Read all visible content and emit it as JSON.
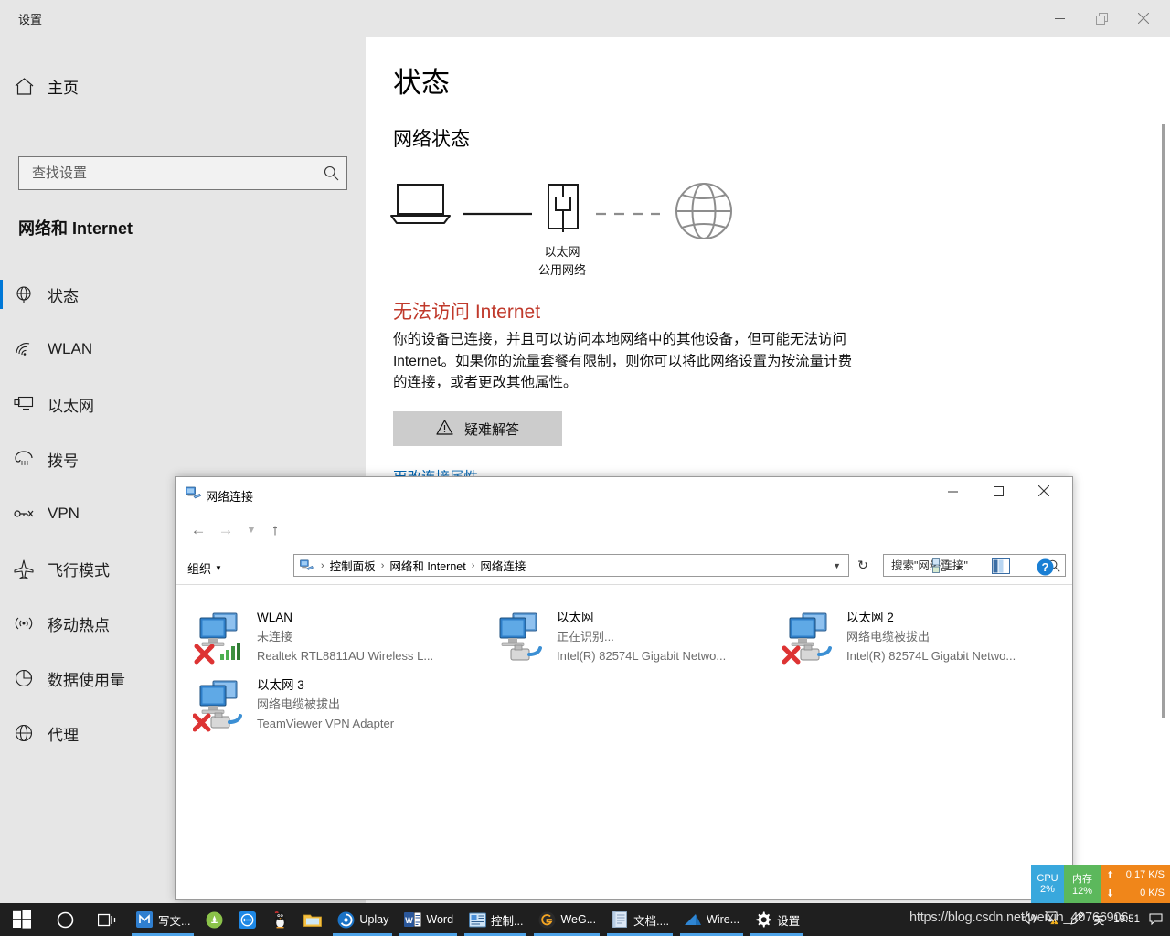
{
  "settings": {
    "window_title": "设置",
    "titlebar_buttons": {
      "minimize": "minimize-icon",
      "maximize": "maximize-icon",
      "close": "close-icon"
    },
    "home_label": "主页",
    "search_placeholder": "查找设置",
    "search_value": "",
    "category_title": "网络和 Internet",
    "nav_items": [
      {
        "label": "状态",
        "icon": "globe-status-icon",
        "selected": true
      },
      {
        "label": "WLAN",
        "icon": "wifi-icon",
        "selected": false
      },
      {
        "label": "以太网",
        "icon": "ethernet-icon",
        "selected": false
      },
      {
        "label": "拨号",
        "icon": "dialup-phone-icon",
        "selected": false
      },
      {
        "label": "VPN",
        "icon": "vpn-key-icon",
        "selected": false
      },
      {
        "label": "飞行模式",
        "icon": "airplane-icon",
        "selected": false
      },
      {
        "label": "移动热点",
        "icon": "hotspot-icon",
        "selected": false
      },
      {
        "label": "数据使用量",
        "icon": "data-usage-pie-icon",
        "selected": false
      },
      {
        "label": "代理",
        "icon": "proxy-globe-icon",
        "selected": false
      }
    ],
    "page_title": "状态",
    "section_title": "网络状态",
    "diagram": {
      "device_icon": "laptop-icon",
      "adapter_icon": "ethernet-port-icon",
      "internet_icon": "globe-icon",
      "adapter_label": "以太网",
      "network_type_label": "公用网络"
    },
    "status_headline": "无法访问 Internet",
    "status_headline_color": "#c0392b",
    "status_body": "你的设备已连接，并且可以访问本地网络中的其他设备，但可能无法访问 Internet。如果你的流量套餐有限制，则你可以将此网络设置为按流量计费的连接，或者更改其他属性。",
    "troubleshoot_label": "疑难解答",
    "change_props_link": "更改连接属性",
    "accent_color": "#0078d7"
  },
  "explorer": {
    "window_title": "网络连接",
    "titlebar_buttons": {
      "minimize": "minimize-icon",
      "maximize": "maximize-icon",
      "close": "close-icon"
    },
    "breadcrumbs": [
      "控制面板",
      "网络和 Internet",
      "网络连接"
    ],
    "search_placeholder": "搜索\"网络连接\"",
    "search_value": "",
    "organize_label": "组织",
    "connections": [
      {
        "name": "WLAN",
        "state": "未连接",
        "device": "Realtek RTL8811AU Wireless L...",
        "icon": "network-adapter-icon",
        "overlay": "red-x-icon",
        "badge": "wifi-bars-icon"
      },
      {
        "name": "以太网",
        "state": "正在识别...",
        "device": "Intel(R) 82574L Gigabit Netwo...",
        "icon": "network-adapter-icon",
        "overlay": "none",
        "badge": "rj45-plug-icon"
      },
      {
        "name": "以太网 2",
        "state": "网络电缆被拔出",
        "device": "Intel(R) 82574L Gigabit Netwo...",
        "icon": "network-adapter-icon",
        "overlay": "red-x-icon",
        "badge": "rj45-plug-icon"
      },
      {
        "name": "以太网 3",
        "state": "网络电缆被拔出",
        "device": "TeamViewer VPN Adapter",
        "icon": "network-adapter-icon",
        "overlay": "red-x-icon",
        "badge": "rj45-plug-icon"
      }
    ]
  },
  "perf_widget": {
    "cpu_label": "CPU",
    "cpu_value": "2%",
    "mem_label": "内存",
    "mem_value": "12%",
    "up_value": "0.17 K/S",
    "down_value": "0 K/S",
    "cpu_color": "#39a8dd",
    "mem_color": "#5cb85c",
    "net_color": "#f0861a"
  },
  "taskbar": {
    "start_icon": "windows-start-icon",
    "cortana_icon": "cortana-circle-icon",
    "taskview_icon": "task-view-icon",
    "apps": [
      {
        "label": "写文...",
        "icon": "maxthon-icon",
        "open": true,
        "color": "#2f7fd0"
      },
      {
        "label": "",
        "icon": "android-studio-icon",
        "open": false,
        "color": "#8bc34a"
      },
      {
        "label": "",
        "icon": "teamviewer-icon",
        "open": false,
        "color": "#1e88e5"
      },
      {
        "label": "",
        "icon": "qq-penguin-icon",
        "open": false,
        "color": "#e8e8e8"
      },
      {
        "label": "",
        "icon": "file-explorer-icon",
        "open": false,
        "color": "#f5c043"
      },
      {
        "label": "Uplay",
        "icon": "uplay-icon",
        "open": true,
        "color": "#1a73c7"
      },
      {
        "label": "Word",
        "icon": "word-icon",
        "open": true,
        "color": "#2b579a"
      },
      {
        "label": "控制...",
        "icon": "control-panel-icon",
        "open": true,
        "color": "#4a90d9"
      },
      {
        "label": "WeG...",
        "icon": "wegame-icon",
        "open": true,
        "color": "#f5a623"
      },
      {
        "label": "文档....",
        "icon": "notepad-doc-icon",
        "open": true,
        "color": "#dbe7f5"
      },
      {
        "label": "Wire...",
        "icon": "wireshark-icon",
        "open": true,
        "color": "#1e6fb8"
      },
      {
        "label": "设置",
        "icon": "settings-gear-icon",
        "open": true,
        "color": "#ffffff"
      }
    ],
    "tray": {
      "ime_label": "英",
      "volume_icon": "volume-icon",
      "network_warning_icon": "network-warning-icon",
      "pen_icon": "pen-icon",
      "time": "19:51",
      "notification_icon": "notification-icon"
    },
    "watermark": "https://blog.csdn.net/weixin_40766906"
  }
}
